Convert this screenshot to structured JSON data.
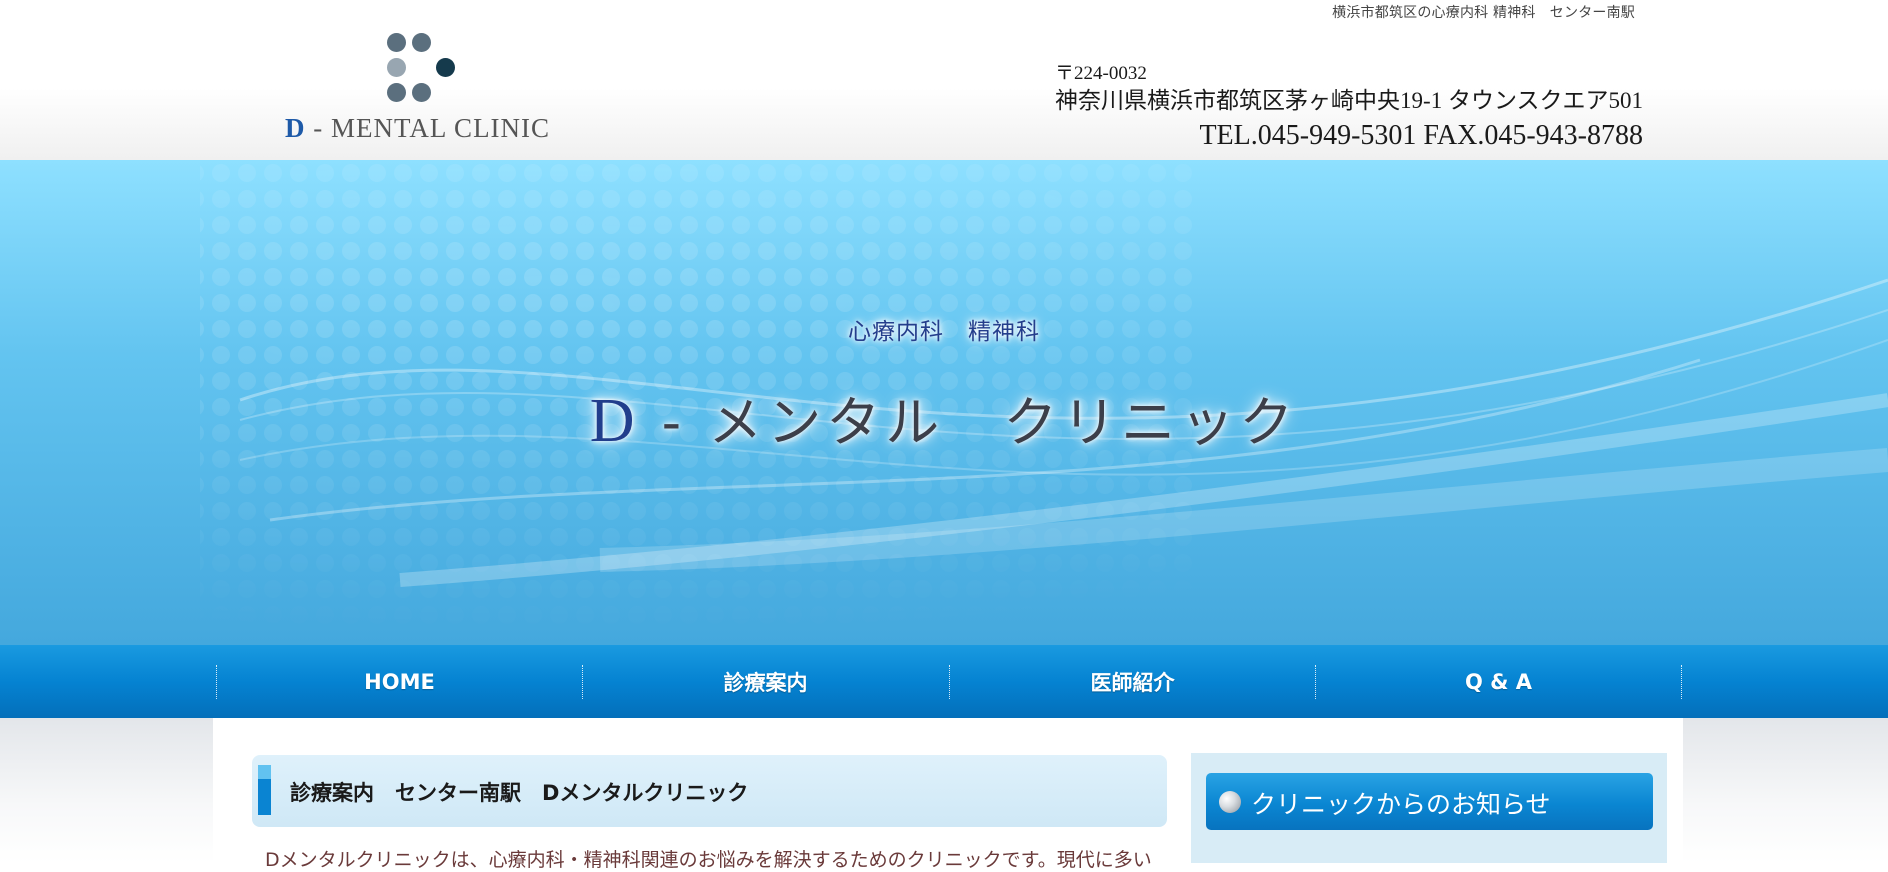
{
  "header": {
    "tagline": "横浜市都筑区の心療内科 精神科　センター南駅",
    "logo_text_d": "D",
    "logo_text_rest": " - MENTAL CLINIC",
    "postal": "〒224-0032",
    "address": "神奈川県横浜市都筑区茅ヶ崎中央19-1 タウンスクエア501",
    "phone": "TEL.045-949-5301  FAX.045-943-8788",
    "logo_dot_colors": [
      "#5b6f7e",
      "#5b6f7e",
      "#98a6b1",
      "#153a4c",
      "#5b6f7e",
      "#5b6f7e"
    ]
  },
  "hero": {
    "subtitle": "心療内科　精神科",
    "title_d": "D",
    "title_rest": " - メンタル　クリニック"
  },
  "nav": {
    "items": [
      {
        "label": "HOME"
      },
      {
        "label": "診療案内"
      },
      {
        "label": "医師紹介"
      },
      {
        "label": "Q & A"
      }
    ]
  },
  "main": {
    "heading": "診療案内　センター南駅　Dメンタルクリニック",
    "intro": "Dメンタルクリニックは、心療内科・精神科関連のお悩みを解決するためのクリニックです。現代に多い"
  },
  "sidebar": {
    "notice_label": "クリニックからのお知らせ"
  },
  "colors": {
    "nav_blue": "#0583d2",
    "hero_blue": "#63c4f0",
    "heading_bar": "#0a84d2"
  }
}
